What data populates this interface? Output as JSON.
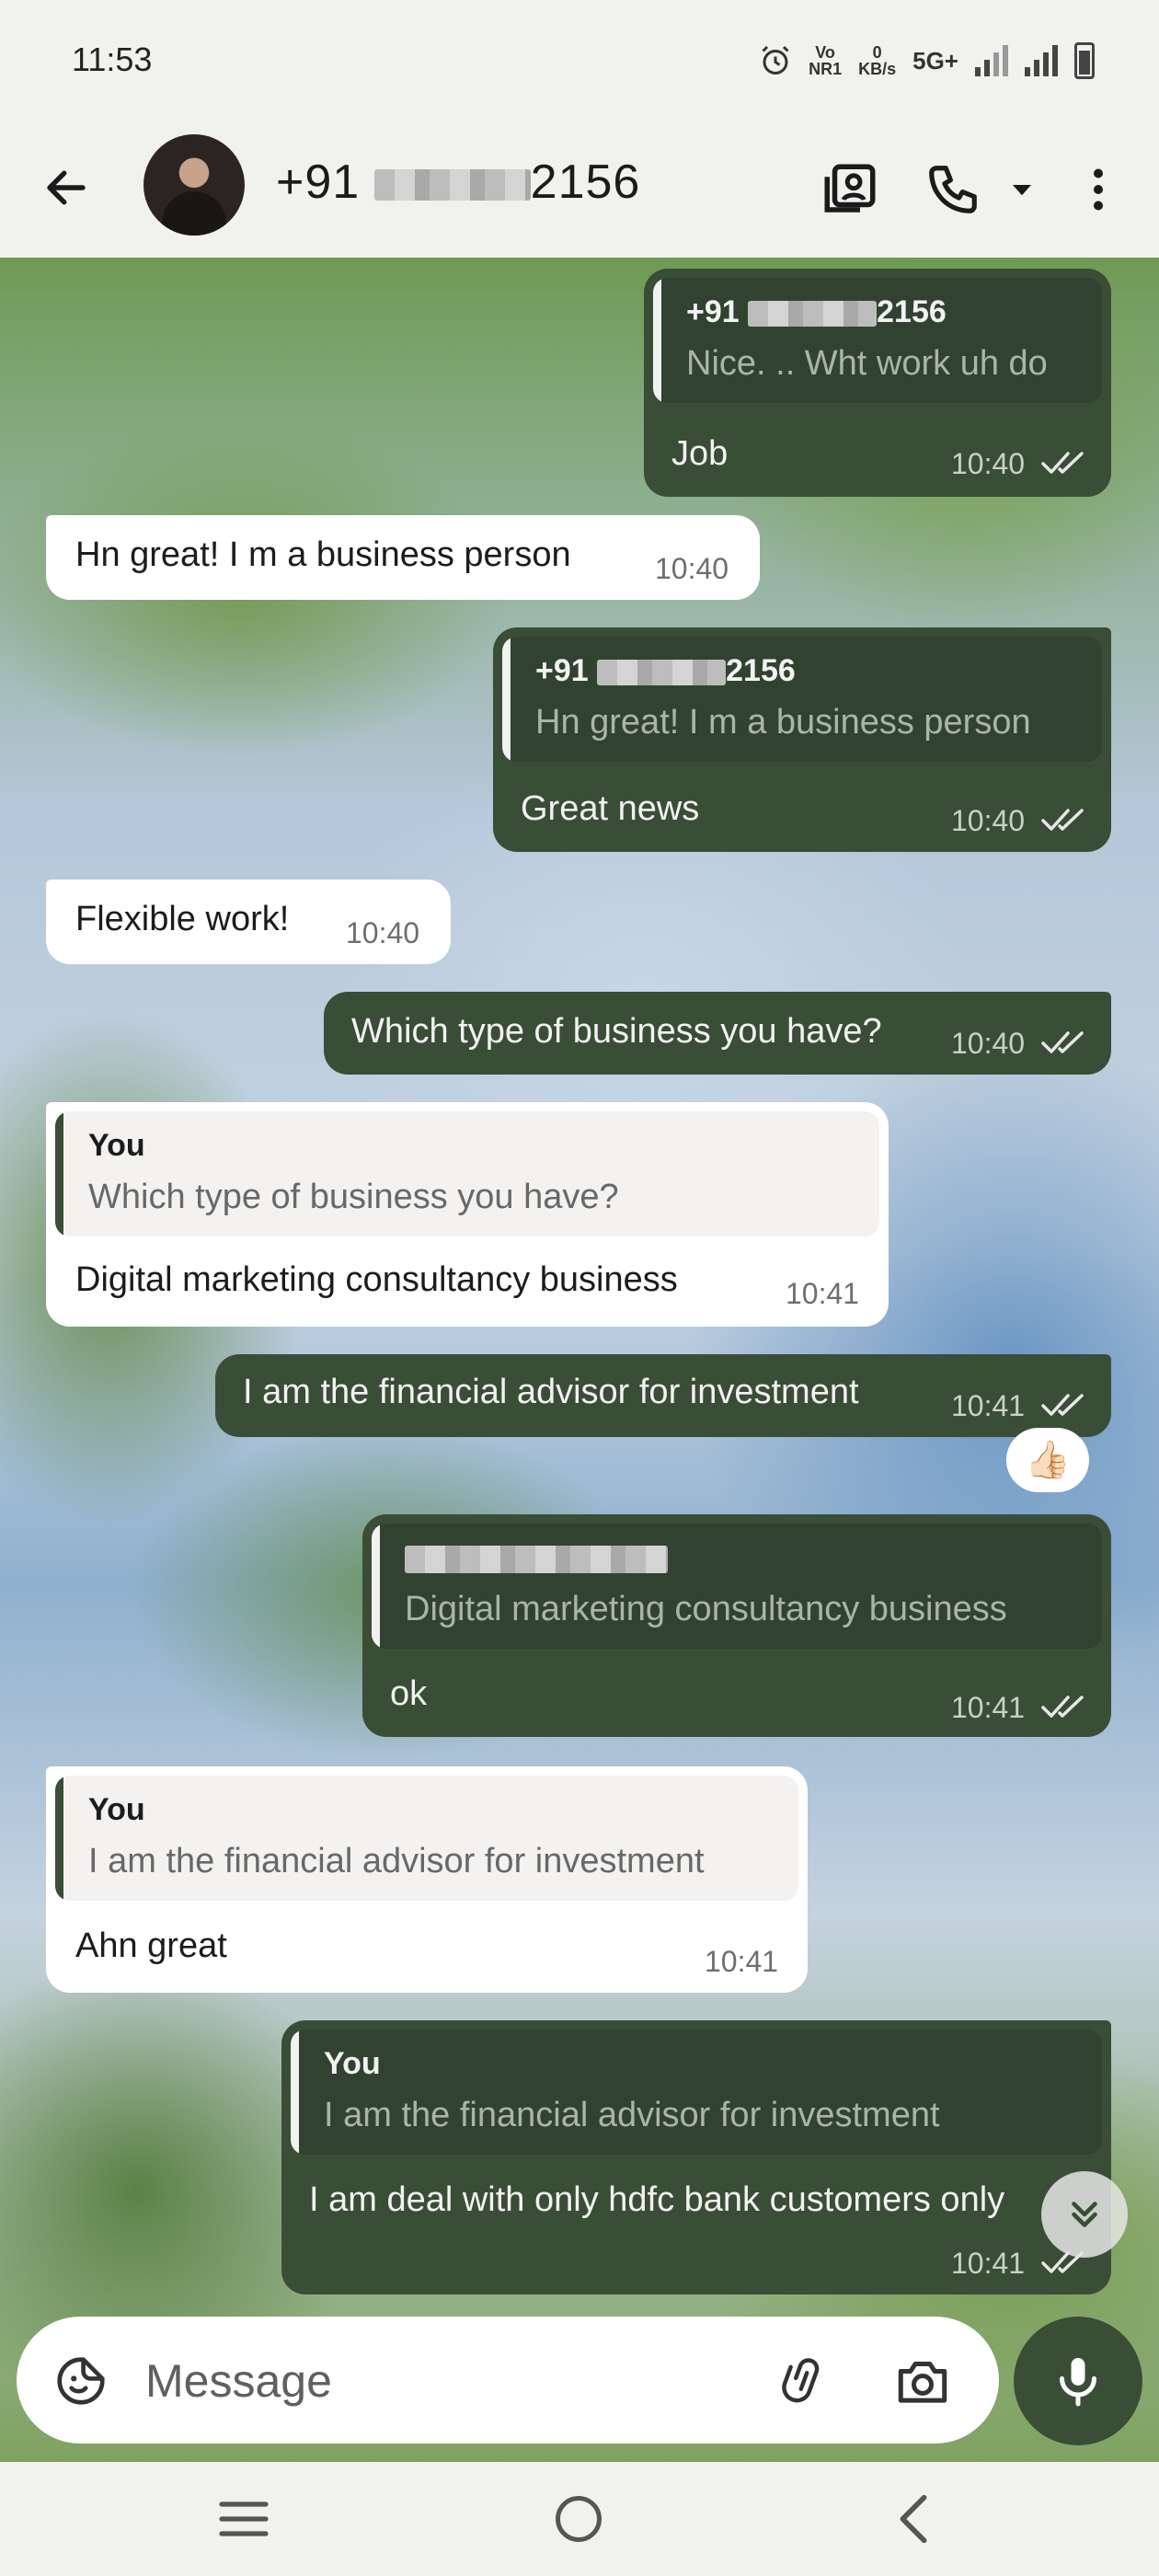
{
  "status_bar": {
    "time": "11:53",
    "vo": "Vo",
    "nr": "NR1",
    "speed_value": "0",
    "speed_unit": "KB/s",
    "network": "5G+"
  },
  "header": {
    "contact_prefix": "+91",
    "contact_suffix": "2156"
  },
  "messages": [
    {
      "direction": "outgoing",
      "quote_author_prefix": "+91",
      "quote_author_suffix": "2156",
      "quote_text": "Nice. .. Wht work uh do",
      "text": "Job",
      "time": "10:40",
      "status": "read"
    },
    {
      "direction": "incoming",
      "text": "Hn great! I m a business person",
      "time": "10:40"
    },
    {
      "direction": "outgoing",
      "quote_author_prefix": "+91",
      "quote_author_suffix": "2156",
      "quote_text": "Hn great! I m a business person",
      "text": "Great news",
      "time": "10:40",
      "status": "read"
    },
    {
      "direction": "incoming",
      "text": "Flexible work!",
      "time": "10:40"
    },
    {
      "direction": "outgoing",
      "text": "Which type of business you have?",
      "time": "10:40",
      "status": "read"
    },
    {
      "direction": "incoming",
      "quote_author": "You",
      "quote_text": "Which type of business you have?",
      "text": "Digital marketing consultancy business",
      "time": "10:41"
    },
    {
      "direction": "outgoing",
      "text": "I am the financial advisor for investment",
      "time": "10:41",
      "status": "read",
      "reaction": "👍🏻"
    },
    {
      "direction": "outgoing",
      "quote_author": "",
      "quote_text": "Digital marketing consultancy business",
      "text": "ok",
      "time": "10:41",
      "status": "read"
    },
    {
      "direction": "incoming",
      "quote_author": "You",
      "quote_text": "I am the financial advisor for investment",
      "text": "Ahn great",
      "time": "10:41"
    },
    {
      "direction": "outgoing",
      "quote_author": "You",
      "quote_text": "I am the financial advisor for investment",
      "text": "I am deal with only hdfc bank customers only",
      "time": "10:41",
      "status": "read"
    }
  ],
  "composer": {
    "placeholder": "Message"
  },
  "icons": {
    "back": "arrow-left-icon",
    "contact_card": "contact-card-icon",
    "call": "phone-icon",
    "call_menu": "dropdown-arrow-icon",
    "overflow": "more-vert-icon",
    "emoji": "sticker-smile-icon",
    "attach": "paperclip-icon",
    "camera": "camera-icon",
    "mic": "microphone-icon",
    "scroll_down": "double-chevron-down-icon",
    "nav_recents": "recents-icon",
    "nav_home": "home-icon",
    "nav_back": "nav-back-icon"
  },
  "colors": {
    "outgoing_bubble": "#3a4d36",
    "incoming_bubble": "#ffffff",
    "bars": "#f1f1ee"
  }
}
